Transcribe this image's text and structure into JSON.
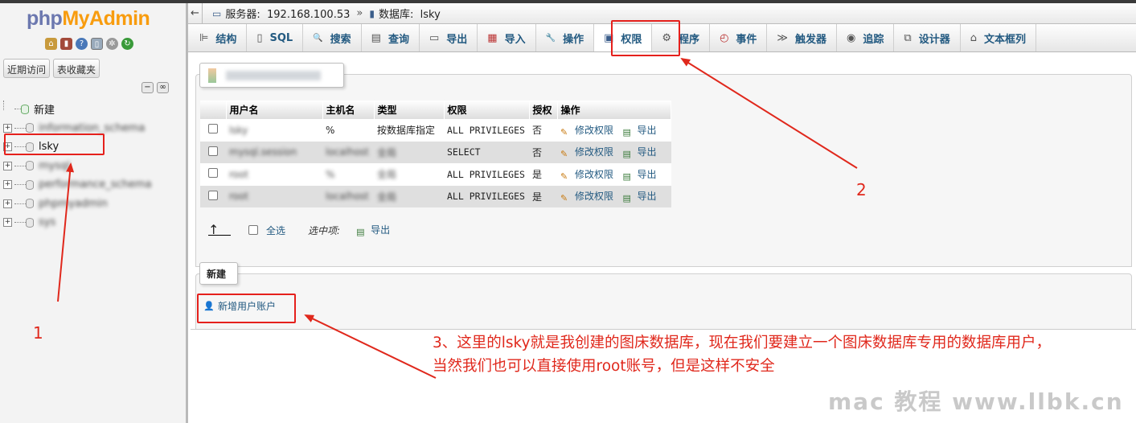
{
  "app": {
    "logo_php": "php",
    "logo_myadmin": "MyAdmin"
  },
  "sidebar": {
    "recent_button": "近期访问",
    "favorites_button": "表收藏夹",
    "tree": [
      {
        "label": "新建",
        "blurred": false
      },
      {
        "label": "information_schema",
        "blurred": true
      },
      {
        "label": "lsky",
        "blurred": false
      },
      {
        "label": "mysql",
        "blurred": true
      },
      {
        "label": "performance_schema",
        "blurred": true
      },
      {
        "label": "phpmyadmin",
        "blurred": true
      },
      {
        "label": "sys",
        "blurred": true
      }
    ]
  },
  "breadcrumb": {
    "server_label": "服务器:",
    "server_value": "192.168.100.53",
    "separator": "»",
    "db_label": "数据库:",
    "db_value": "lsky"
  },
  "tabs": [
    {
      "label": "结构",
      "icon": "structure-icon",
      "glyph": "⊫"
    },
    {
      "label": "SQL",
      "icon": "sql-icon",
      "glyph": "▯"
    },
    {
      "label": "搜索",
      "icon": "search-icon",
      "glyph": "🔍"
    },
    {
      "label": "查询",
      "icon": "query-icon",
      "glyph": "▤"
    },
    {
      "label": "导出",
      "icon": "export-icon",
      "glyph": "▭"
    },
    {
      "label": "导入",
      "icon": "import-icon",
      "glyph": "▦"
    },
    {
      "label": "操作",
      "icon": "wrench-icon",
      "glyph": "🔧"
    },
    {
      "label": "权限",
      "icon": "privileges-icon",
      "glyph": "▣",
      "active": true
    },
    {
      "label": "程序",
      "icon": "routines-icon",
      "glyph": "⚙"
    },
    {
      "label": "事件",
      "icon": "events-icon",
      "glyph": "◴"
    },
    {
      "label": "触发器",
      "icon": "triggers-icon",
      "glyph": "≫"
    },
    {
      "label": "追踪",
      "icon": "tracking-icon",
      "glyph": "◉"
    },
    {
      "label": "设计器",
      "icon": "designer-icon",
      "glyph": "⧉"
    },
    {
      "label": "文本框列",
      "icon": "columns-icon",
      "glyph": "⌂"
    }
  ],
  "users_table": {
    "headers": [
      "",
      "用户名",
      "主机名",
      "类型",
      "权限",
      "授权",
      "操作"
    ],
    "rows": [
      {
        "user": "lsky",
        "host": "%",
        "type": "按数据库指定",
        "priv": "ALL PRIVILEGES",
        "grant": "否",
        "user_blur": true,
        "host_blur": false,
        "type_blur": false
      },
      {
        "user": "mysql.session",
        "host": "localhost",
        "type": "全局",
        "priv": "SELECT",
        "grant": "否",
        "user_blur": true,
        "host_blur": true,
        "type_blur": true
      },
      {
        "user": "root",
        "host": "%",
        "type": "全局",
        "priv": "ALL PRIVILEGES",
        "grant": "是",
        "user_blur": true,
        "host_blur": true,
        "type_blur": true
      },
      {
        "user": "root",
        "host": "localhost",
        "type": "全局",
        "priv": "ALL PRIVILEGES",
        "grant": "是",
        "user_blur": true,
        "host_blur": true,
        "type_blur": true
      }
    ],
    "edit_label": "修改权限",
    "export_label": "导出"
  },
  "footer_actions": {
    "select_all": "全选",
    "with_selected": "选中项:",
    "export": "导出"
  },
  "new_section": {
    "legend": "新建",
    "add_user": "新增用户账户"
  },
  "annotations": {
    "num1": "1",
    "num2": "2",
    "note_line1": "3、这里的lsky就是我创建的图床数据库，现在我们要建立一个图床数据库专用的数据库用户，",
    "note_line2": "当然我们也可以直接使用root账号，但是这样不安全",
    "color": "#e0281c"
  },
  "watermark": "mac 教程 www.llbk.cn"
}
